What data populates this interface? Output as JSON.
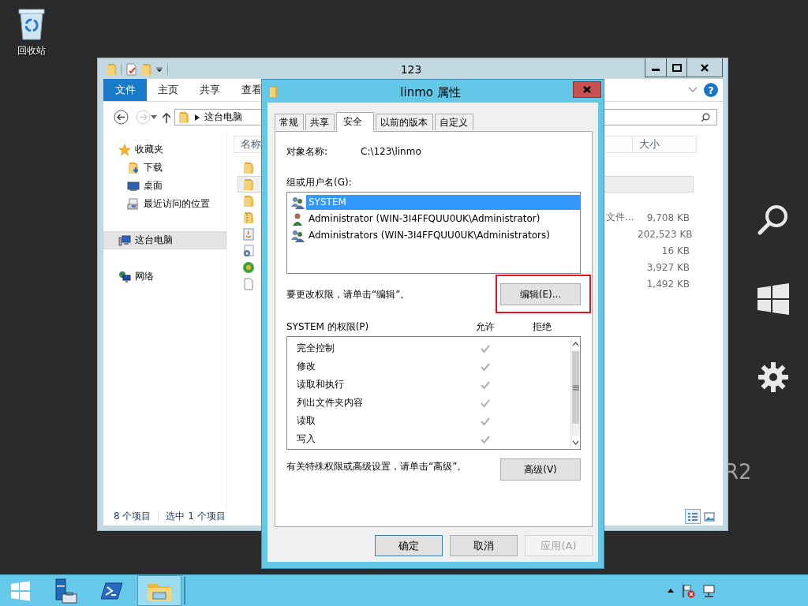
{
  "desktop": {
    "recycle_bin_label": "回收站",
    "wallpaper_text": "R2"
  },
  "explorer": {
    "title": "123",
    "ribbon_tabs": [
      {
        "label": "文件",
        "selected": true
      },
      {
        "label": "主页",
        "selected": false
      },
      {
        "label": "共享",
        "selected": false
      },
      {
        "label": "查看",
        "selected": false
      }
    ],
    "help": "?",
    "address": "这台电脑",
    "nav": [
      {
        "label": "收藏夹",
        "kind": "favorites",
        "selected": false,
        "children": [
          {
            "label": "下载",
            "kind": "downloads",
            "selected": false
          },
          {
            "label": "桌面",
            "kind": "desktop",
            "selected": false
          },
          {
            "label": "最近访问的位置",
            "kind": "recent",
            "selected": false
          }
        ]
      },
      {
        "label": "这台电脑",
        "kind": "computer",
        "selected": true
      },
      {
        "label": "网络",
        "kind": "network",
        "selected": false
      }
    ],
    "columns": [
      "名称",
      "大小"
    ],
    "files": [
      {
        "kind": "folder",
        "selected": false
      },
      {
        "kind": "folder",
        "selected": true
      },
      {
        "kind": "folder",
        "selected": false
      },
      {
        "kind": "zip",
        "type": "文件...",
        "size": "9,708 KB",
        "selected": false
      },
      {
        "kind": "app",
        "size": "202,523 KB",
        "selected": false
      },
      {
        "kind": "settings",
        "size": "16 KB",
        "selected": false
      },
      {
        "kind": "installer",
        "size": "3,927 KB",
        "selected": false
      },
      {
        "kind": "file",
        "size": "1,492 KB",
        "selected": false
      }
    ],
    "status": [
      "8 个项目",
      "选中 1 个项目"
    ]
  },
  "dialog": {
    "title": "linmo 属性",
    "tabs": [
      {
        "label": "常规",
        "selected": false
      },
      {
        "label": "共享",
        "selected": false
      },
      {
        "label": "安全",
        "selected": true
      },
      {
        "label": "以前的版本",
        "selected": false
      },
      {
        "label": "自定义",
        "selected": false
      }
    ],
    "object_label": "对象名称:",
    "object_value": "C:\\123\\linmo",
    "group_label": "组或用户名(G):",
    "principals": [
      {
        "name": "SYSTEM",
        "kind": "group",
        "selected": true
      },
      {
        "name": "Administrator (WIN-3I4FFQUU0UK\\Administrator)",
        "kind": "user",
        "selected": false
      },
      {
        "name": "Administrators (WIN-3I4FFQUU0UK\\Administrators)",
        "kind": "group",
        "selected": false
      }
    ],
    "edit_hint": "要更改权限，请单击“编辑”。",
    "edit_button": {
      "label": "编辑(E)...",
      "highlighted": true
    },
    "permissions_label": "SYSTEM 的权限(P)",
    "allow_header": "允许",
    "deny_header": "拒绝",
    "permissions": [
      {
        "name": "完全控制",
        "allow": true,
        "deny": false
      },
      {
        "name": "修改",
        "allow": true,
        "deny": false
      },
      {
        "name": "读取和执行",
        "allow": true,
        "deny": false
      },
      {
        "name": "列出文件夹内容",
        "allow": true,
        "deny": false
      },
      {
        "name": "读取",
        "allow": true,
        "deny": false
      },
      {
        "name": "写入",
        "allow": true,
        "deny": false
      }
    ],
    "advanced_hint": "有关特殊权限或高级设置，请单击“高级”。",
    "advanced_button": "高级(V)",
    "buttons": [
      {
        "label": "确定",
        "kind": "default"
      },
      {
        "label": "取消",
        "kind": "normal"
      },
      {
        "label": "应用(A)",
        "kind": "disabled"
      }
    ]
  },
  "taskbar": {
    "items": [
      {
        "kind": "start",
        "active": false
      },
      {
        "kind": "server-manager",
        "active": false
      },
      {
        "kind": "powershell",
        "active": false
      },
      {
        "kind": "explorer",
        "active": true
      }
    ]
  }
}
